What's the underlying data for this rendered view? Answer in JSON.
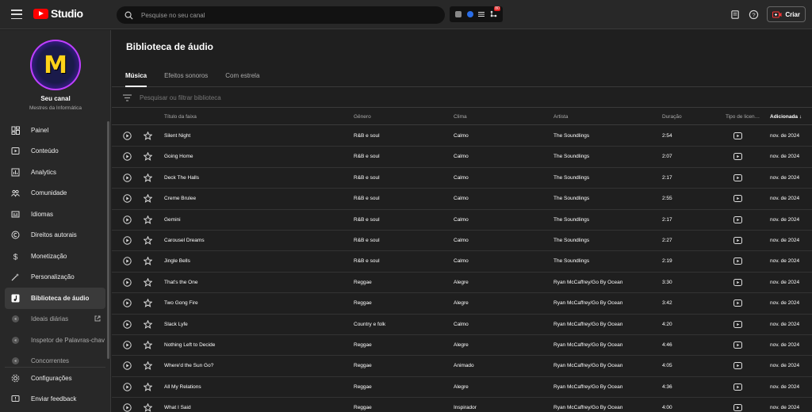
{
  "header": {
    "logo_text": "Studio",
    "search_placeholder": "Pesquise no seu canal",
    "create_label": "Criar",
    "notification_count": "80"
  },
  "channel": {
    "avatar_letter": "M",
    "title": "Seu canal",
    "subtitle": "Mestres da Informática"
  },
  "sidebar": {
    "items": [
      {
        "label": "Painel",
        "icon": "dashboard-icon"
      },
      {
        "label": "Conteúdo",
        "icon": "content-icon"
      },
      {
        "label": "Analytics",
        "icon": "analytics-icon"
      },
      {
        "label": "Comunidade",
        "icon": "community-icon"
      },
      {
        "label": "Idiomas",
        "icon": "subtitles-icon"
      },
      {
        "label": "Direitos autorais",
        "icon": "copyright-icon"
      },
      {
        "label": "Monetização",
        "icon": "dollar-icon"
      },
      {
        "label": "Personalização",
        "icon": "magic-wand-icon"
      },
      {
        "label": "Biblioteca de áudio",
        "icon": "audio-library-icon"
      },
      {
        "label": "Ideais diárias",
        "icon": "extension-icon"
      },
      {
        "label": "Inspetor de Palavras-chav",
        "icon": "extension-icon"
      },
      {
        "label": "Concorrentes",
        "icon": "extension-icon"
      }
    ],
    "bottom_items": [
      {
        "label": "Configurações",
        "icon": "gear-icon"
      },
      {
        "label": "Enviar feedback",
        "icon": "feedback-icon"
      }
    ]
  },
  "main": {
    "page_title": "Biblioteca de áudio",
    "tabs": [
      "Música",
      "Efeitos sonoros",
      "Com estrela"
    ],
    "active_tab": "Música",
    "filter_placeholder": "Pesquisar ou filtrar biblioteca",
    "columns": {
      "title": "Título da faixa",
      "genre": "Gênero",
      "mood": "Clima",
      "artist": "Artista",
      "duration": "Duração",
      "license": "Tipo de licen…",
      "added": "Adicionada",
      "sort_arrow": "↓"
    },
    "rows": [
      {
        "title": "Silent Night",
        "genre": "R&B e soul",
        "mood": "Calmo",
        "artist": "The Soundlings",
        "duration": "2:54",
        "added": "nov. de 2024"
      },
      {
        "title": "Going Home",
        "genre": "R&B e soul",
        "mood": "Calmo",
        "artist": "The Soundlings",
        "duration": "2:07",
        "added": "nov. de 2024"
      },
      {
        "title": "Deck The Halls",
        "genre": "R&B e soul",
        "mood": "Calmo",
        "artist": "The Soundlings",
        "duration": "2:17",
        "added": "nov. de 2024"
      },
      {
        "title": "Creme Brulee",
        "genre": "R&B e soul",
        "mood": "Calmo",
        "artist": "The Soundlings",
        "duration": "2:55",
        "added": "nov. de 2024"
      },
      {
        "title": "Gemini",
        "genre": "R&B e soul",
        "mood": "Calmo",
        "artist": "The Soundlings",
        "duration": "2:17",
        "added": "nov. de 2024"
      },
      {
        "title": "Carousel Dreams",
        "genre": "R&B e soul",
        "mood": "Calmo",
        "artist": "The Soundlings",
        "duration": "2:27",
        "added": "nov. de 2024"
      },
      {
        "title": "Jingle Bells",
        "genre": "R&B e soul",
        "mood": "Calmo",
        "artist": "The Soundlings",
        "duration": "2:19",
        "added": "nov. de 2024"
      },
      {
        "title": "That's the One",
        "genre": "Reggae",
        "mood": "Alegre",
        "artist": "Ryan McCaffrey/Go By Ocean",
        "duration": "3:30",
        "added": "nov. de 2024"
      },
      {
        "title": "Two Gong Fire",
        "genre": "Reggae",
        "mood": "Alegre",
        "artist": "Ryan McCaffrey/Go By Ocean",
        "duration": "3:42",
        "added": "nov. de 2024"
      },
      {
        "title": "Slack Lyfe",
        "genre": "Country e folk",
        "mood": "Calmo",
        "artist": "Ryan McCaffrey/Go By Ocean",
        "duration": "4:20",
        "added": "nov. de 2024"
      },
      {
        "title": "Nothing Left to Decide",
        "genre": "Reggae",
        "mood": "Alegre",
        "artist": "Ryan McCaffrey/Go By Ocean",
        "duration": "4:46",
        "added": "nov. de 2024"
      },
      {
        "title": "Where'd the Sun Go?",
        "genre": "Reggae",
        "mood": "Animado",
        "artist": "Ryan McCaffrey/Go By Ocean",
        "duration": "4:05",
        "added": "nov. de 2024"
      },
      {
        "title": "All My Relations",
        "genre": "Reggae",
        "mood": "Alegre",
        "artist": "Ryan McCaffrey/Go By Ocean",
        "duration": "4:36",
        "added": "nov. de 2024"
      },
      {
        "title": "What I Said",
        "genre": "Reggae",
        "mood": "Inspirador",
        "artist": "Ryan McCaffrey/Go By Ocean",
        "duration": "4:00",
        "added": "nov. de 2024"
      }
    ]
  },
  "colors": {
    "brand_red": "#ff0000",
    "background": "#1f1f1f",
    "surface": "#282828",
    "avatar_accent": "#c040ff"
  }
}
